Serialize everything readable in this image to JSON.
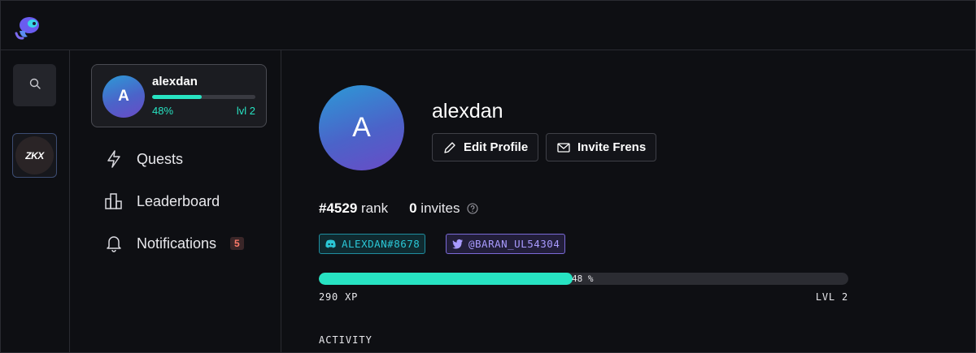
{
  "app": {
    "logo_icon": "mascot-logo-icon"
  },
  "rail": {
    "search_icon": "search-icon",
    "community_badge": "ZKX"
  },
  "user_card": {
    "avatar_initial": "A",
    "name": "alexdan",
    "progress_percent": 48,
    "progress_label": "48%",
    "level_label": "lvl 2"
  },
  "nav": {
    "items": [
      {
        "label": "Quests",
        "icon": "lightning-icon"
      },
      {
        "label": "Leaderboard",
        "icon": "leaderboard-icon"
      },
      {
        "label": "Notifications",
        "icon": "bell-icon",
        "badge": "5"
      }
    ]
  },
  "profile": {
    "avatar_initial": "A",
    "name": "alexdan",
    "edit_label": "Edit Profile",
    "invite_label": "Invite Frens",
    "rank_value": "#4529",
    "rank_label": "rank",
    "invites_value": "0",
    "invites_label": "invites",
    "discord_handle": "ALEXDAN#8678",
    "twitter_handle": "@BARAN_UL54304",
    "xp_percent": 48,
    "xp_percent_label": "48 %",
    "xp_label": "290 XP",
    "level_label": "LVL 2",
    "activity_heading": "ACTIVITY"
  },
  "colors": {
    "accent": "#27e3c2",
    "background": "#0e0f13",
    "discord": "#2bc7d6",
    "twitter": "#a99bff",
    "badge": "#ff7a6a"
  }
}
